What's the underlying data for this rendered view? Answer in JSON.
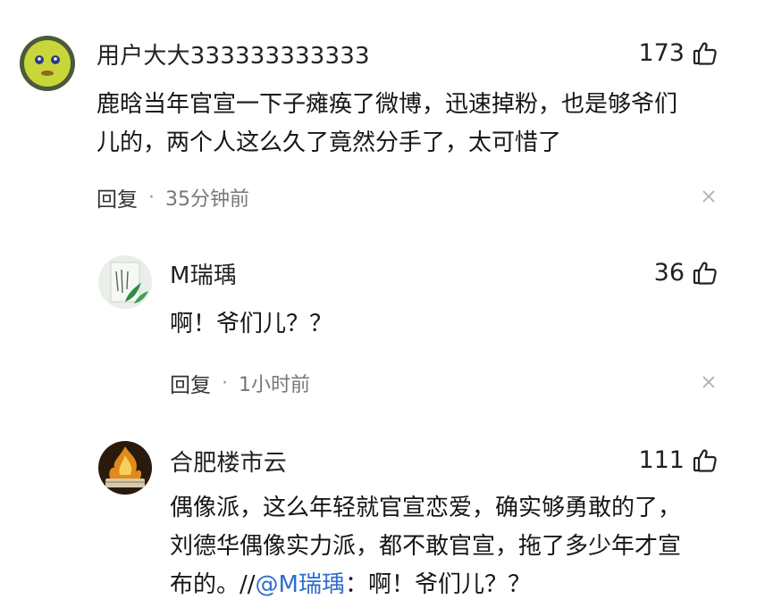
{
  "comments": [
    {
      "username": "用户大大333333333333",
      "likes": "173",
      "lines": [
        "鹿晗当年官宣一下子瘫痪了微博，迅速掉粉，也是够爷们",
        "儿的，两个人这么久了竟然分手了，太可惜了"
      ],
      "reply_label": "回复",
      "separator": "·",
      "time": "35分钟前"
    },
    {
      "username": "M瑞瑀",
      "likes": "36",
      "lines": [
        "啊！爷们儿？？"
      ],
      "reply_label": "回复",
      "separator": "·",
      "time": "1小时前"
    },
    {
      "username": "合肥楼市云",
      "likes": "111",
      "lines": [
        "偶像派，这么年轻就官宣恋爱，确实够勇敢的了，",
        "刘德华偶像实力派，都不敢官宣，拖了多少年才宣"
      ],
      "last_line_prefix": "布的。//",
      "mention": "@M瑞瑀",
      "last_line_suffix": "：啊！爷们儿？？"
    }
  ],
  "icons": {
    "like": "thumbs-up-icon",
    "close": "close-icon"
  },
  "colors": {
    "mention": "#2f6bd0",
    "meta": "#777777",
    "text": "#161616"
  }
}
